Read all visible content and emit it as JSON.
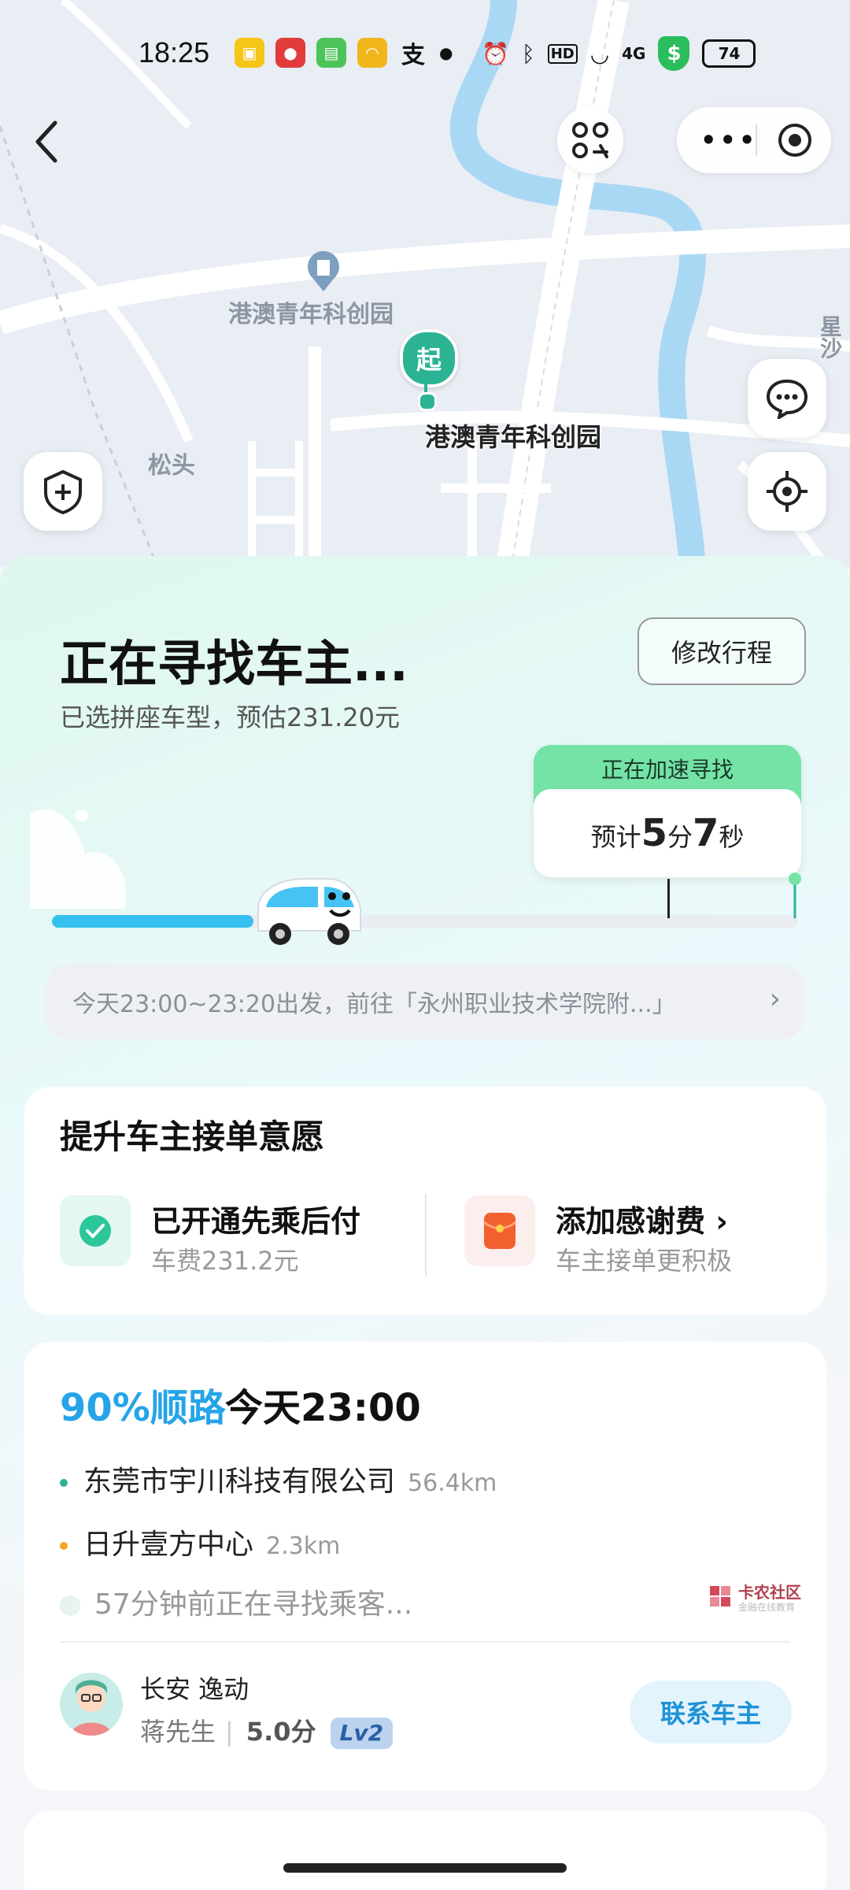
{
  "status_bar": {
    "time": "18:25",
    "battery": "74",
    "network": "4G",
    "hd": "HD",
    "app_icons": [
      {
        "name": "app-yellow-icon",
        "color": "#f5c518"
      },
      {
        "name": "app-red-icon",
        "color": "#e23b3b"
      },
      {
        "name": "app-green-icon",
        "color": "#4cc45a"
      },
      {
        "name": "app-orange-icon",
        "color": "#f2b61d"
      },
      {
        "name": "alipay-icon",
        "color": "#111111"
      }
    ]
  },
  "map": {
    "poi_label": "港澳青年科创园",
    "start_pin_label": "起",
    "start_location": "港澳青年科创园",
    "area_label": "松头",
    "side_label": "星沙"
  },
  "trip": {
    "status_title": "正在寻找车主...",
    "subtitle": "已选拼座车型，预估231.20元",
    "modify_button": "修改行程",
    "accelerating": "正在加速寻找",
    "eta_prefix": "预计",
    "eta_min": "5",
    "eta_min_unit": "分",
    "eta_sec": "7",
    "eta_sec_unit": "秒",
    "progress": 0.27,
    "route_summary": "今天23:00~23:20出发，前往「永州职业技术学院附...」"
  },
  "boost": {
    "heading": "提升车主接单意愿",
    "pay_later": {
      "title": "已开通先乘后付",
      "sub": "车费231.2元"
    },
    "thanks_fee": {
      "title": "添加感谢费",
      "arrow": "›",
      "sub": "车主接单更积极"
    }
  },
  "driver_card": {
    "match": "90%顺路",
    "time": "今天23:00",
    "stops": [
      {
        "name": "东莞市宇川科技有限公司",
        "distance": "56.4km",
        "color": "#2bb394"
      },
      {
        "name": "日升壹方中心",
        "distance": "2.3km",
        "color": "#f5a623"
      }
    ],
    "finding": "57分钟前正在寻找乘客...",
    "car_model": "长安 逸动",
    "driver_name": "蒋先生",
    "rating": "5.0分",
    "level": "Lv2",
    "contact_button": "联系车主"
  },
  "watermark": {
    "name": "卡农社区",
    "sub": "金融在线教育"
  }
}
